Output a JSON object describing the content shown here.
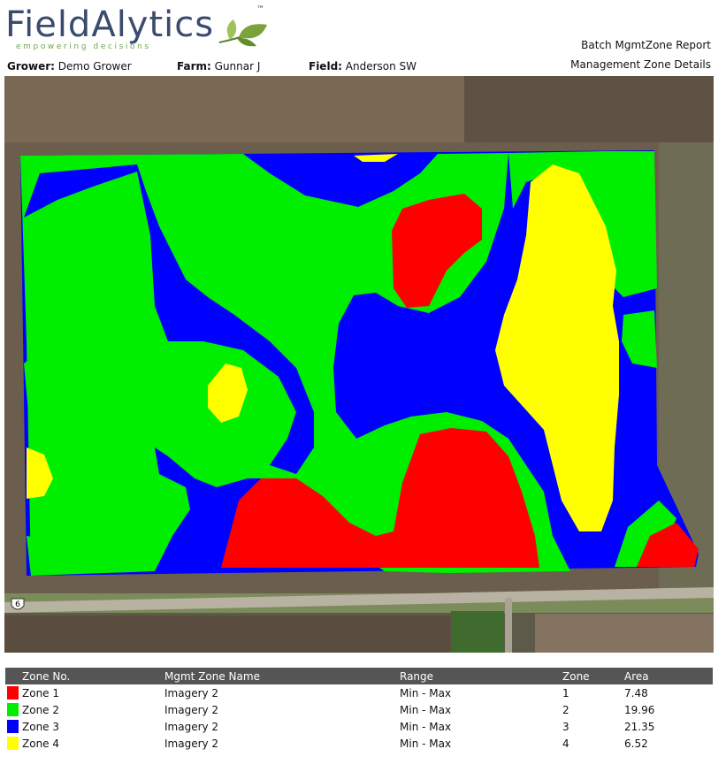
{
  "brand": {
    "name": "FieldAlytics",
    "tagline": "empowering decisions",
    "tm": "™"
  },
  "report": {
    "title": "Batch MgmtZone Report",
    "subtitle": "Management Zone Details"
  },
  "meta": {
    "grower_label": "Grower:",
    "grower": "Demo Grower",
    "farm_label": "Farm:",
    "farm": "Gunnar J",
    "field_label": "Field:",
    "field": "Anderson SW"
  },
  "map": {
    "road_shield": "6"
  },
  "colors": {
    "zone1": "#ff0000",
    "zone2": "#00ee00",
    "zone3": "#0000ff",
    "zone4": "#ffff00",
    "header": "#555555"
  },
  "table": {
    "headers": [
      "Zone No.",
      "Mgmt Zone Name",
      "Range",
      "Zone",
      "Area"
    ],
    "rows": [
      {
        "zone_no": "Zone 1",
        "name": "Imagery 2",
        "range": "Min - Max",
        "zone": "1",
        "area": "7.48"
      },
      {
        "zone_no": "Zone 2",
        "name": "Imagery 2",
        "range": "Min - Max",
        "zone": "2",
        "area": "19.96"
      },
      {
        "zone_no": "Zone 3",
        "name": "Imagery 2",
        "range": "Min - Max",
        "zone": "3",
        "area": "21.35"
      },
      {
        "zone_no": "Zone 4",
        "name": "Imagery 2",
        "range": "Min - Max",
        "zone": "4",
        "area": "6.52"
      }
    ]
  }
}
